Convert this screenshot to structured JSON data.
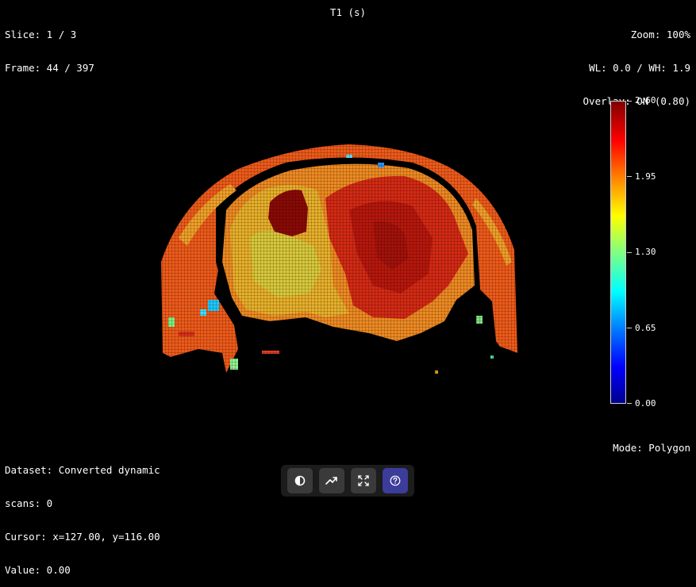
{
  "info": {
    "slice": "Slice: 1 / 3",
    "frame": "Frame: 44 / 397",
    "map_title": "T1 (s)",
    "zoom": "Zoom: 100%",
    "window": "WL: 0.0 / WH: 1.9",
    "overlay": "Overlay: ON (0.80)",
    "dataset": "Dataset: Converted dynamic",
    "scans": "scans: 0",
    "cursor": "Cursor: x=127.00, y=116.00",
    "value": "Value: 0.00",
    "mode": "Mode: Polygon"
  },
  "colorbar": {
    "labels": [
      "2.60",
      "1.95",
      "1.30",
      "0.65",
      "0.00"
    ]
  },
  "toolbar": {
    "buttons": [
      {
        "icon": "contrast-icon",
        "active": false
      },
      {
        "icon": "trend-icon",
        "active": false
      },
      {
        "icon": "fullscreen-icon",
        "active": false
      },
      {
        "icon": "help-icon",
        "active": true
      }
    ]
  },
  "colors": {
    "background": "#000000",
    "toolbar": "#1c1c1c",
    "button": "#3a3a3a",
    "active_button": "#3c3c9a"
  }
}
